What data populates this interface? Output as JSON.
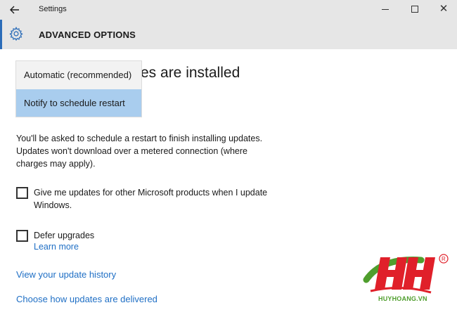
{
  "window": {
    "title": "Settings",
    "close_glyph": "✕",
    "back_icon": "arrow-left-icon"
  },
  "header": {
    "title": "ADVANCED OPTIONS",
    "icon": "gear-icon",
    "accent_color": "#2b6cb8"
  },
  "page": {
    "heading_partial": "es are installed"
  },
  "install_dropdown": {
    "options": [
      {
        "label": "Automatic (recommended)",
        "selected": false
      },
      {
        "label": "Notify to schedule restart",
        "selected": true
      }
    ],
    "highlight_color": "#a9cdee"
  },
  "description": {
    "lines": [
      "You'll be asked to schedule a restart to finish installing updates.",
      "Updates won't download over a metered connection (where",
      "charges may apply)."
    ]
  },
  "options": {
    "microsoft_products": {
      "lines": [
        "Give me updates for other Microsoft products when I update",
        "Windows."
      ],
      "checked": false
    },
    "defer_upgrades": {
      "label": "Defer upgrades",
      "checked": false,
      "learn_more": "Learn more"
    }
  },
  "links": {
    "history": "View your update history",
    "delivery": "Choose how updates are delivered",
    "color": "#1f6fc5"
  },
  "watermark": {
    "text": "HUYHOANG.VN",
    "logo_letters": "HH",
    "registered": "®",
    "colors": {
      "primary": "#e0202a",
      "secondary": "#4f9e2d"
    }
  }
}
